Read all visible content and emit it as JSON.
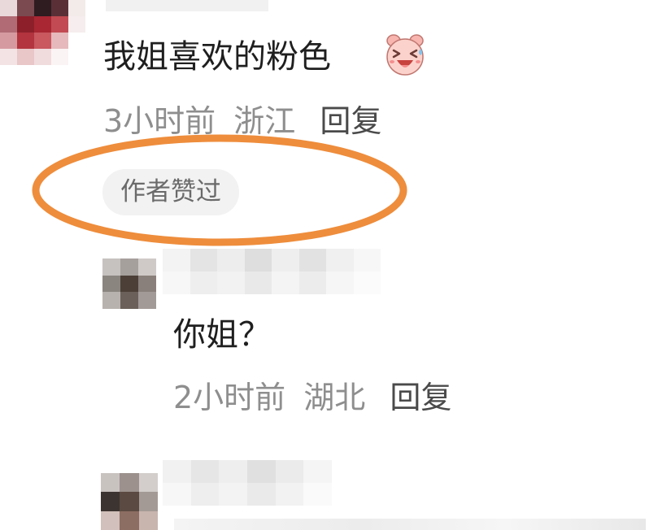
{
  "comment1": {
    "text": "我姐喜欢的粉色",
    "emoji_icon": "laughing-pig-emoji",
    "time": "3小时前",
    "location": "浙江",
    "reply_label": "回复",
    "badge": "作者赞过"
  },
  "reply1": {
    "text": "你姐？",
    "time": "2小时前",
    "location": "湖北",
    "reply_label": "回复"
  },
  "colors": {
    "annotation": "#ee8d3c",
    "badge_bg": "#f2f2f2",
    "meta_text": "#8e8e8e",
    "reply_text": "#4a4a4a",
    "body_text": "#1f1f1f"
  }
}
